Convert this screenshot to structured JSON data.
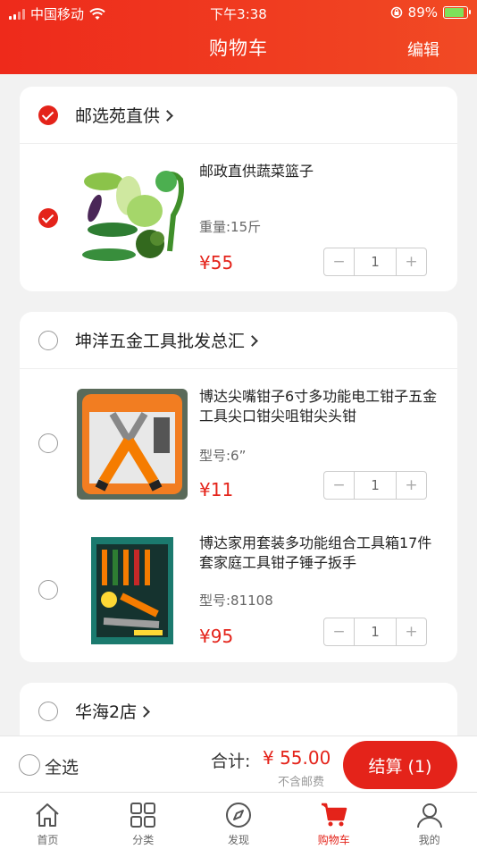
{
  "status": {
    "carrier": "中国移动",
    "time": "下午3:38",
    "battery": "89%"
  },
  "header": {
    "title": "购物车",
    "edit": "编辑"
  },
  "shops": [
    {
      "name": "邮选苑直供",
      "items": [
        {
          "name": "邮政直供蔬菜篮子",
          "spec": "重量:15斤",
          "price": "¥55",
          "qty": "1"
        }
      ]
    },
    {
      "name": "坤洋五金工具批发总汇",
      "items": [
        {
          "name": "博达尖嘴钳子6寸多功能电工钳子五金工具尖口钳尖咀钳尖头钳",
          "spec": "型号:6”",
          "price": "¥11",
          "qty": "1"
        },
        {
          "name": "博达家用套装多功能组合工具箱17件套家庭工具钳子锤子扳手",
          "spec": "型号:81108",
          "price": "¥95",
          "qty": "1"
        }
      ]
    },
    {
      "name": "华海2店"
    }
  ],
  "stepper": {
    "minus": "−",
    "plus": "+"
  },
  "footer": {
    "select_all": "全选",
    "total_label": "合计:",
    "total_value": "¥ 55.00",
    "shipping": "不含邮费",
    "checkout": "结算 (1)"
  },
  "tabs": [
    {
      "label": "首页",
      "icon": "home-icon"
    },
    {
      "label": "分类",
      "icon": "category-icon"
    },
    {
      "label": "发现",
      "icon": "compass-icon"
    },
    {
      "label": "购物车",
      "icon": "cart-icon",
      "active": true
    },
    {
      "label": "我的",
      "icon": "user-icon"
    }
  ],
  "colors": {
    "accent": "#e4231a",
    "header_start": "#ee2a1b",
    "header_end": "#f14a24"
  }
}
